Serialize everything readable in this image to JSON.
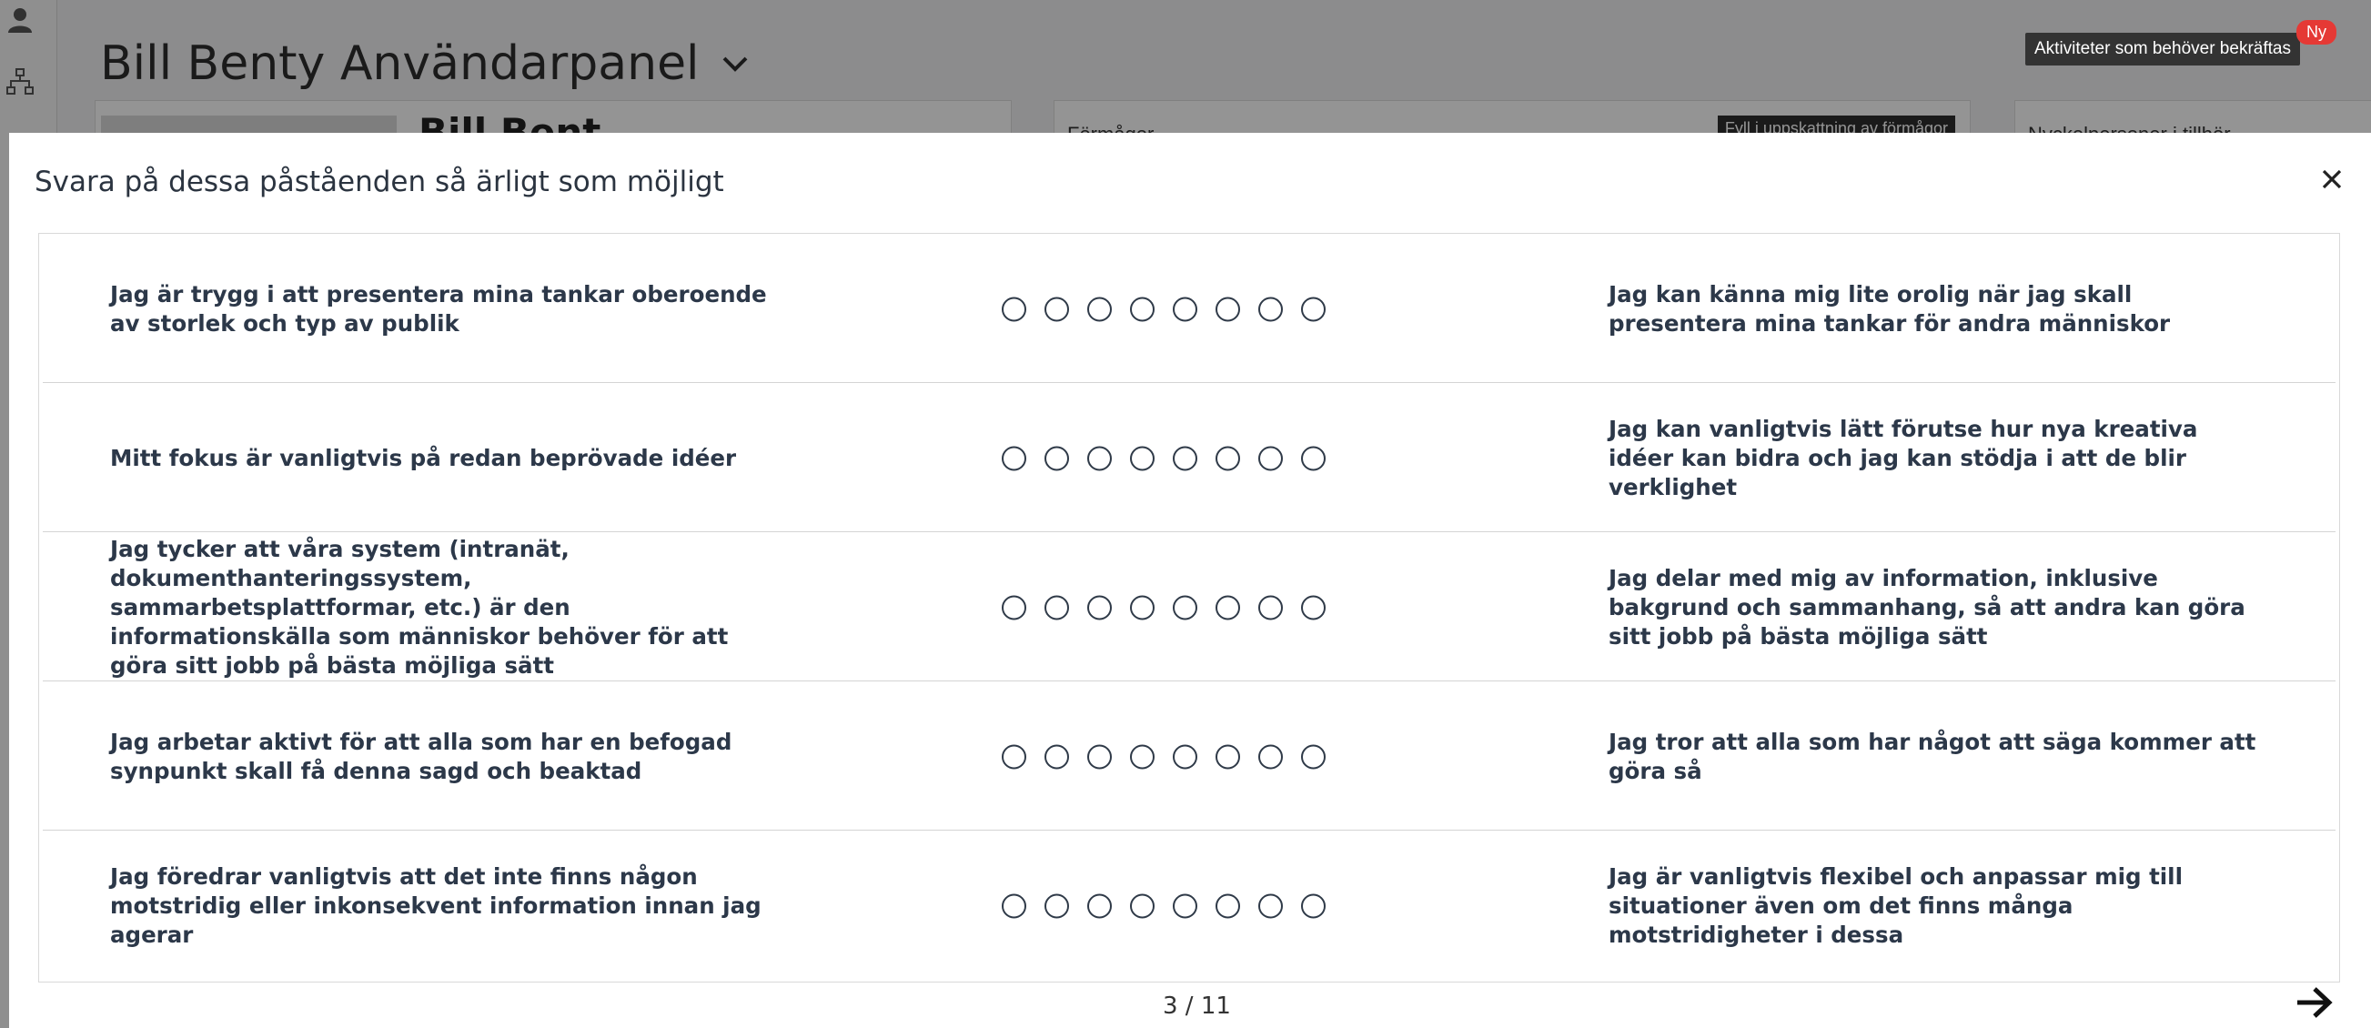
{
  "background": {
    "page_title": "Bill Benty Användarpanel",
    "profile_name_partial": "Bill Bent",
    "card_abilities_title": "Förmågor",
    "card_abilities_chip": "Fyll i uppskattning av förmågor",
    "card_right_title": "Nyckelpersoner i tillhör",
    "activities_button": "Aktiviteter som behöver bekräftas",
    "new_badge": "Ny"
  },
  "modal": {
    "title": "Svara på dessa påståenden så ärligt som möjligt",
    "close_icon": "close-icon",
    "scale_points": 8,
    "rows": [
      {
        "left": "Jag är trygg i att presentera mina tankar oberoende av storlek och typ av publik",
        "right": "Jag kan känna mig lite orolig när jag skall presentera mina tankar för andra människor"
      },
      {
        "left": "Mitt fokus är vanligtvis på redan beprövade idéer",
        "right": "Jag kan vanligtvis lätt förutse hur nya kreativa idéer kan bidra och jag kan stödja i att de blir verklighet"
      },
      {
        "left": "Jag tycker att våra system (intranät, dokumenthanteringssystem, sammarbetsplattformar, etc.) är den informationskälla som människor behöver för att göra sitt jobb på bästa möjliga sätt",
        "right": "Jag delar med mig av information, inklusive bakgrund och sammanhang, så att andra kan göra sitt jobb på bästa möjliga sätt"
      },
      {
        "left": "Jag arbetar aktivt för att alla som har en befogad synpunkt skall få denna sagd och beaktad",
        "right": "Jag tror att alla som har något att säga kommer att göra så"
      },
      {
        "left": "Jag föredrar vanligtvis att det inte finns någon motstridig eller inkonsekvent information innan jag agerar",
        "right": "Jag är vanligtvis flexibel och anpassar mig till situationer även om det finns många motstridigheter i dessa"
      }
    ],
    "pager": "3 / 11",
    "next_icon": "arrow-right-icon"
  }
}
